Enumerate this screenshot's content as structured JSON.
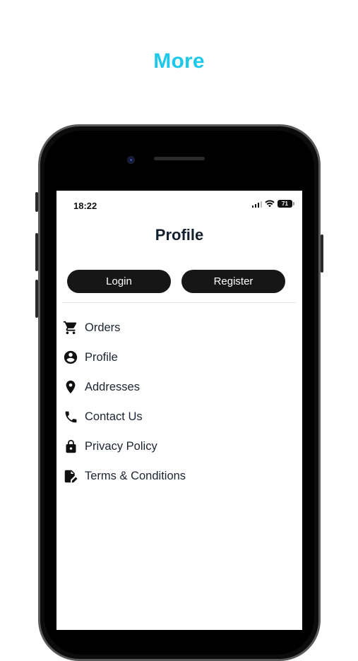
{
  "header": {
    "title": "More"
  },
  "status_bar": {
    "time": "18:22",
    "battery": "71"
  },
  "screen": {
    "title": "Profile",
    "buttons": {
      "login": "Login",
      "register": "Register"
    },
    "menu": [
      {
        "label": "Orders",
        "icon": "cart-icon"
      },
      {
        "label": "Profile",
        "icon": "account-circle-icon"
      },
      {
        "label": "Addresses",
        "icon": "location-pin-icon"
      },
      {
        "label": "Contact Us",
        "icon": "phone-icon"
      },
      {
        "label": "Privacy Policy",
        "icon": "lock-icon"
      },
      {
        "label": "Terms & Conditions",
        "icon": "document-edit-icon"
      }
    ]
  },
  "colors": {
    "accent": "#1ec8ea",
    "button": "#161616",
    "text": "#1d2430"
  }
}
